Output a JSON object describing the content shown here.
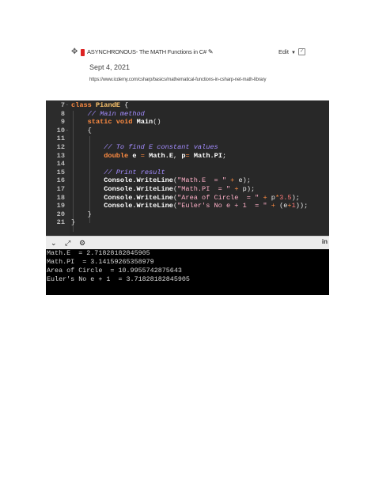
{
  "note": {
    "title": "ASYNCHRONOUS- The MATH Functions in C#",
    "date": "Sept 4, 2021",
    "url": "https://www.icdemy.com/csharp/basics/mathematical-functions-in-csharp-net-math-library",
    "edit_label": "Edit",
    "icons": {
      "drag": "drag-handle-icon",
      "pin": "pin-icon",
      "edit_pencil": "pencil-icon",
      "chevron": "chevron-down-icon",
      "check": "checkbox-icon"
    }
  },
  "editor": {
    "lines": [
      {
        "num": "7",
        "fold": "-",
        "tokens": [
          [
            "kw",
            "class"
          ],
          [
            "pl",
            " "
          ],
          [
            "ty",
            "PiandE"
          ],
          [
            "pl",
            " {"
          ]
        ]
      },
      {
        "num": "8",
        "fold": "",
        "tokens": [
          [
            "pl",
            "    "
          ],
          [
            "cm",
            "// Main method"
          ]
        ]
      },
      {
        "num": "9",
        "fold": "",
        "tokens": [
          [
            "pl",
            "    "
          ],
          [
            "kw",
            "static"
          ],
          [
            "pl",
            " "
          ],
          [
            "kw",
            "void"
          ],
          [
            "pl",
            " "
          ],
          [
            "id",
            "Main"
          ],
          [
            "pl",
            "()"
          ]
        ]
      },
      {
        "num": "10",
        "fold": "-",
        "tokens": [
          [
            "pl",
            "    {"
          ]
        ]
      },
      {
        "num": "11",
        "fold": "",
        "tokens": []
      },
      {
        "num": "12",
        "fold": "",
        "tokens": [
          [
            "pl",
            "        "
          ],
          [
            "cm",
            "// To find E constant values"
          ]
        ]
      },
      {
        "num": "13",
        "fold": "",
        "tokens": [
          [
            "pl",
            "        "
          ],
          [
            "kw",
            "double"
          ],
          [
            "pl",
            " "
          ],
          [
            "id",
            "e"
          ],
          [
            "pl",
            " "
          ],
          [
            "op",
            "="
          ],
          [
            "pl",
            " "
          ],
          [
            "id",
            "Math.E"
          ],
          [
            "pl",
            ", "
          ],
          [
            "id",
            "p"
          ],
          [
            "op",
            "="
          ],
          [
            "pl",
            " "
          ],
          [
            "id",
            "Math.PI"
          ],
          [
            "pl",
            ";"
          ]
        ]
      },
      {
        "num": "14",
        "fold": "",
        "tokens": []
      },
      {
        "num": "15",
        "fold": "",
        "tokens": [
          [
            "pl",
            "        "
          ],
          [
            "cm",
            "// Print result"
          ]
        ]
      },
      {
        "num": "16",
        "fold": "",
        "tokens": [
          [
            "pl",
            "        "
          ],
          [
            "id",
            "Console.WriteLine"
          ],
          [
            "pl",
            "("
          ],
          [
            "st",
            "\"Math.E  = \""
          ],
          [
            "pl",
            " "
          ],
          [
            "op",
            "+"
          ],
          [
            "pl",
            " e);"
          ]
        ]
      },
      {
        "num": "17",
        "fold": "",
        "tokens": [
          [
            "pl",
            "        "
          ],
          [
            "id",
            "Console.WriteLine"
          ],
          [
            "pl",
            "("
          ],
          [
            "st",
            "\"Math.PI  = \""
          ],
          [
            "pl",
            " "
          ],
          [
            "op",
            "+"
          ],
          [
            "pl",
            " p);"
          ]
        ]
      },
      {
        "num": "18",
        "fold": "",
        "tokens": [
          [
            "pl",
            "        "
          ],
          [
            "id",
            "Console.WriteLine"
          ],
          [
            "pl",
            "("
          ],
          [
            "st",
            "\"Area of Circle  = \""
          ],
          [
            "pl",
            " "
          ],
          [
            "op",
            "+"
          ],
          [
            "pl",
            " p"
          ],
          [
            "op",
            "*"
          ],
          [
            "nm",
            "3.5"
          ],
          [
            "pl",
            ");"
          ]
        ]
      },
      {
        "num": "19",
        "fold": "",
        "tokens": [
          [
            "pl",
            "        "
          ],
          [
            "id",
            "Console.WriteLine"
          ],
          [
            "pl",
            "("
          ],
          [
            "st",
            "\"Euler's No e + 1  = \""
          ],
          [
            "pl",
            " "
          ],
          [
            "op",
            "+"
          ],
          [
            "pl",
            " (e"
          ],
          [
            "op",
            "+"
          ],
          [
            "nm",
            "1"
          ],
          [
            "pl",
            "));"
          ]
        ]
      },
      {
        "num": "20",
        "fold": "",
        "tokens": [
          [
            "pl",
            "    }"
          ]
        ]
      },
      {
        "num": "21",
        "fold": "",
        "tokens": [
          [
            "pl",
            "}"
          ]
        ]
      }
    ]
  },
  "toolbar": {
    "right_label": "in",
    "icons": [
      "chevron-down-icon",
      "expand-icon",
      "settings-icon"
    ]
  },
  "console": {
    "lines": [
      "Math.E  = 2.71828182845905",
      "Math.PI  = 3.14159265358979",
      "Area of Circle  = 10.9955742875643",
      "Euler's No e + 1  = 3.71828182845905"
    ]
  },
  "colors": {
    "editor_bg": "#282828",
    "keyword": "#ff8c42",
    "type": "#ffc66d",
    "comment": "#a38cff",
    "string": "#ffb0c8",
    "number": "#ff7a7a",
    "console_bg": "#000000"
  }
}
